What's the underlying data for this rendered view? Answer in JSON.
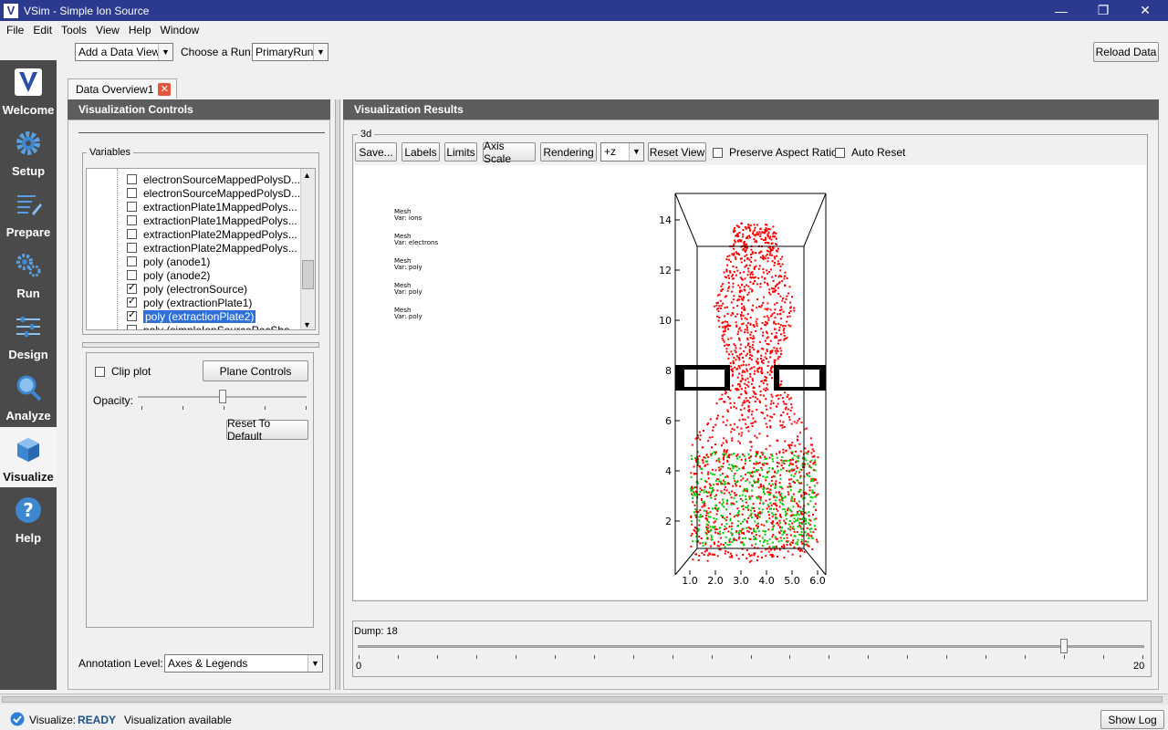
{
  "window": {
    "title": "VSim - Simple Ion Source",
    "logo_letter": "V"
  },
  "menu": [
    "File",
    "Edit",
    "Tools",
    "View",
    "Help",
    "Window"
  ],
  "sidebar": [
    {
      "label": "Welcome",
      "icon": "vsim-logo-icon"
    },
    {
      "label": "Setup",
      "icon": "gear-icon"
    },
    {
      "label": "Prepare",
      "icon": "list-pencil-icon"
    },
    {
      "label": "Run",
      "icon": "gears-icon"
    },
    {
      "label": "Design",
      "icon": "sliders-icon"
    },
    {
      "label": "Analyze",
      "icon": "magnifier-icon"
    },
    {
      "label": "Visualize",
      "icon": "cube-icon"
    },
    {
      "label": "Help",
      "icon": "question-icon"
    }
  ],
  "active_sidebar": "Visualize",
  "toolbar": {
    "data_view": "Add a Data View",
    "choose_run_label": "Choose a Run:",
    "run": "PrimaryRun",
    "reload": "Reload Data"
  },
  "tab": {
    "label": "Data Overview1"
  },
  "controls": {
    "title": "Visualization Controls",
    "variables_label": "Variables",
    "variables": [
      {
        "label": "electronSourceMappedPolysD...",
        "checked": false
      },
      {
        "label": "electronSourceMappedPolysD...",
        "checked": false
      },
      {
        "label": "extractionPlate1MappedPolys...",
        "checked": false
      },
      {
        "label": "extractionPlate1MappedPolys...",
        "checked": false
      },
      {
        "label": "extractionPlate2MappedPolys...",
        "checked": false
      },
      {
        "label": "extractionPlate2MappedPolys...",
        "checked": false
      },
      {
        "label": "poly (anode1)",
        "checked": false
      },
      {
        "label": "poly (anode2)",
        "checked": false
      },
      {
        "label": "poly (electronSource)",
        "checked": true
      },
      {
        "label": "poly (extractionPlate1)",
        "checked": true
      },
      {
        "label": "poly (extractionPlate2)",
        "checked": true,
        "selected": true
      },
      {
        "label": "poly (simpleIonSourcePecSha",
        "checked": false
      }
    ],
    "clip_plot": "Clip plot",
    "plane_controls": "Plane Controls",
    "opacity_label": "Opacity:",
    "opacity": 0.5,
    "reset_default": "Reset To Default",
    "annotation_label": "Annotation Level:",
    "annotation_value": "Axes & Legends"
  },
  "results": {
    "title": "Visualization Results",
    "group": "3d",
    "buttons": {
      "save": "Save...",
      "labels": "Labels",
      "limits": "Limits",
      "axis_scale": "Axis Scale",
      "rendering": "Rendering",
      "reset_view": "Reset View"
    },
    "view_axis": "+z",
    "preserve_aspect": "Preserve Aspect Ratio",
    "auto_reset": "Auto Reset",
    "legends": [
      {
        "mesh": "Mesh",
        "var": "Var: ions"
      },
      {
        "mesh": "Mesh",
        "var": "Var: electrons"
      },
      {
        "mesh": "Mesh",
        "var": "Var: poly"
      },
      {
        "mesh": "Mesh",
        "var": "Var: poly"
      },
      {
        "mesh": "Mesh",
        "var": "Var: poly"
      }
    ],
    "dump_label": "Dump: 18",
    "dump_min": "0",
    "dump_max": "20",
    "dump_value": 18
  },
  "chart_data": {
    "type": "scatter",
    "x_ticks": [
      "1.0",
      "2.0",
      "3.0",
      "4.0",
      "5.0",
      "6.0"
    ],
    "y_ticks": [
      "2",
      "4",
      "6",
      "8",
      "10",
      "12",
      "14"
    ],
    "series": [
      {
        "name": "ions",
        "color": "#ff0000"
      },
      {
        "name": "electrons",
        "color": "#00cc00"
      }
    ]
  },
  "status": {
    "module": "Visualize:",
    "state": "READY",
    "message": "Visualization available",
    "show_log": "Show Log"
  }
}
